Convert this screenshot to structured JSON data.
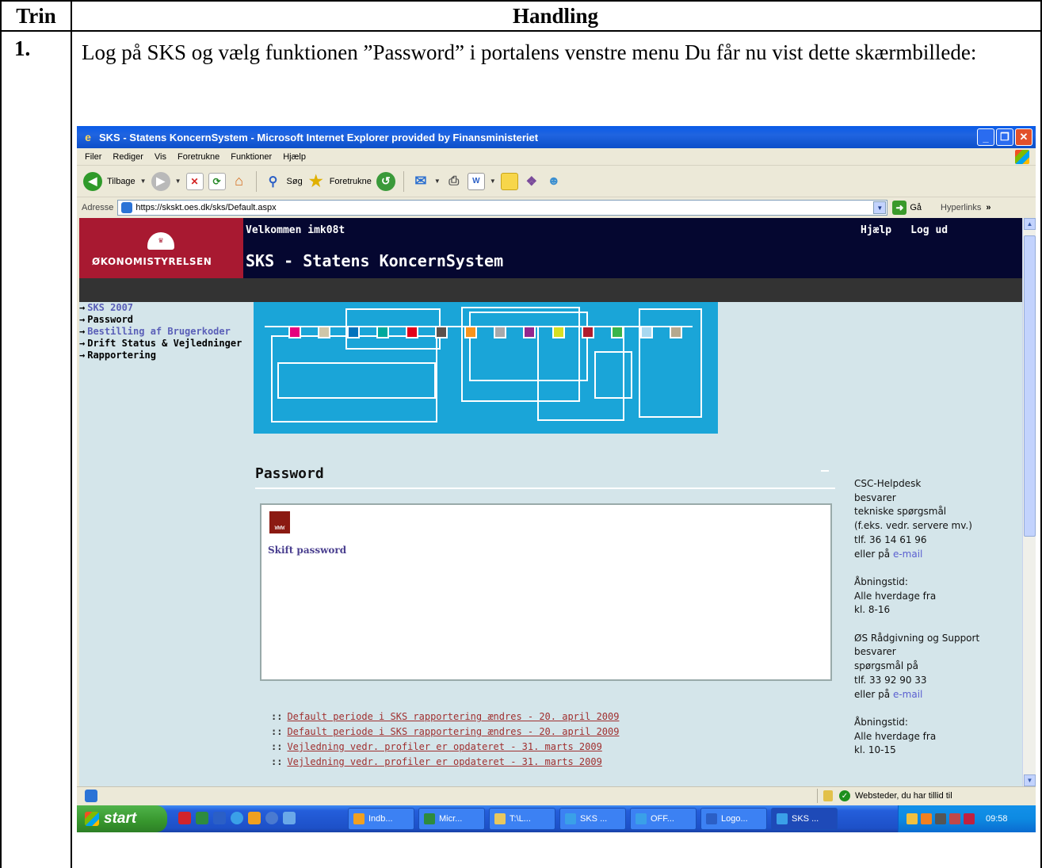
{
  "doc": {
    "col_trin": "Trin",
    "col_handling": "Handling",
    "step_number": "1.",
    "step_text": "Log på SKS og vælg funktionen ”Password” i portalens venstre menu Du får nu vist dette skærmbillede:"
  },
  "browser": {
    "title": "SKS - Statens KoncernSystem - Microsoft Internet Explorer provided by Finansministeriet",
    "menu": [
      "Filer",
      "Rediger",
      "Vis",
      "Foretrukne",
      "Funktioner",
      "Hjælp"
    ],
    "toolbar": {
      "back_label": "Tilbage",
      "search_label": "Søg",
      "favorites_label": "Foretrukne"
    },
    "address_label": "Adresse",
    "address_value": "https://skskt.oes.dk/sks/Default.aspx",
    "go_label": "Gå",
    "links_label": "Hyperlinks",
    "links_chevron": "»",
    "status_zone": "Websteder, du har tillid til"
  },
  "site": {
    "logo_text": "ØKONOMISTYRELSEN",
    "welcome": "Velkommen imk08t",
    "help": "Hjælp",
    "logout": "Log ud",
    "title": "SKS - Statens KoncernSystem",
    "nav": [
      {
        "label": "SKS 2007",
        "style": "blue"
      },
      {
        "label": "Password",
        "style": "dark"
      },
      {
        "label": "Bestilling af Brugerkoder",
        "style": "blue"
      },
      {
        "label": "Drift Status & Vejledninger",
        "style": "dark"
      },
      {
        "label": "Rapportering",
        "style": "dark"
      }
    ],
    "banner_colors": [
      "#e6007e",
      "#cfc6a8",
      "#0072bc",
      "#00a99d",
      "#e2001a",
      "#5b514c",
      "#f7941d",
      "#a7a9ac",
      "#92278f",
      "#d7df23",
      "#b01c2e",
      "#39b54a",
      "#a8d8f0",
      "#b5a88f"
    ],
    "section_title": "Password",
    "pw_icon_text": "WWW",
    "pw_link": "Skift password",
    "news": [
      "Default periode i SKS rapportering ændres - 20. april 2009",
      "Default periode i SKS rapportering ændres - 20. april 2009",
      "Vejledning vedr. profiler er opdateret - 31. marts 2009",
      "Vejledning vedr. profiler er opdateret - 31. marts 2009"
    ],
    "news_marker": "::",
    "info": {
      "csc_lines": [
        "CSC-Helpdesk",
        "besvarer",
        "tekniske spørgsmål",
        "(f.eks. vedr. servere mv.)",
        "tlf. 36 14 61 96"
      ],
      "csc_mail_prefix": "eller på ",
      "csc_mail": "e-mail",
      "csc_hours": [
        "Åbningstid:",
        "Alle hverdage fra",
        "kl. 8-16"
      ],
      "os_lines": [
        "ØS Rådgivning og Support",
        "besvarer",
        "spørgsmål på",
        "tlf. 33 92 90 33"
      ],
      "os_mail_prefix": "eller på ",
      "os_mail": "e-mail",
      "os_hours": [
        "Åbningstid:",
        "Alle hverdage fra",
        "kl. 10-15"
      ]
    }
  },
  "taskbar": {
    "start": "start",
    "tasks": [
      "Indb...",
      "Micr...",
      "T:\\L...",
      "SKS ...",
      "OFF...",
      "Logo...",
      "SKS ..."
    ],
    "clock": "09:58"
  }
}
